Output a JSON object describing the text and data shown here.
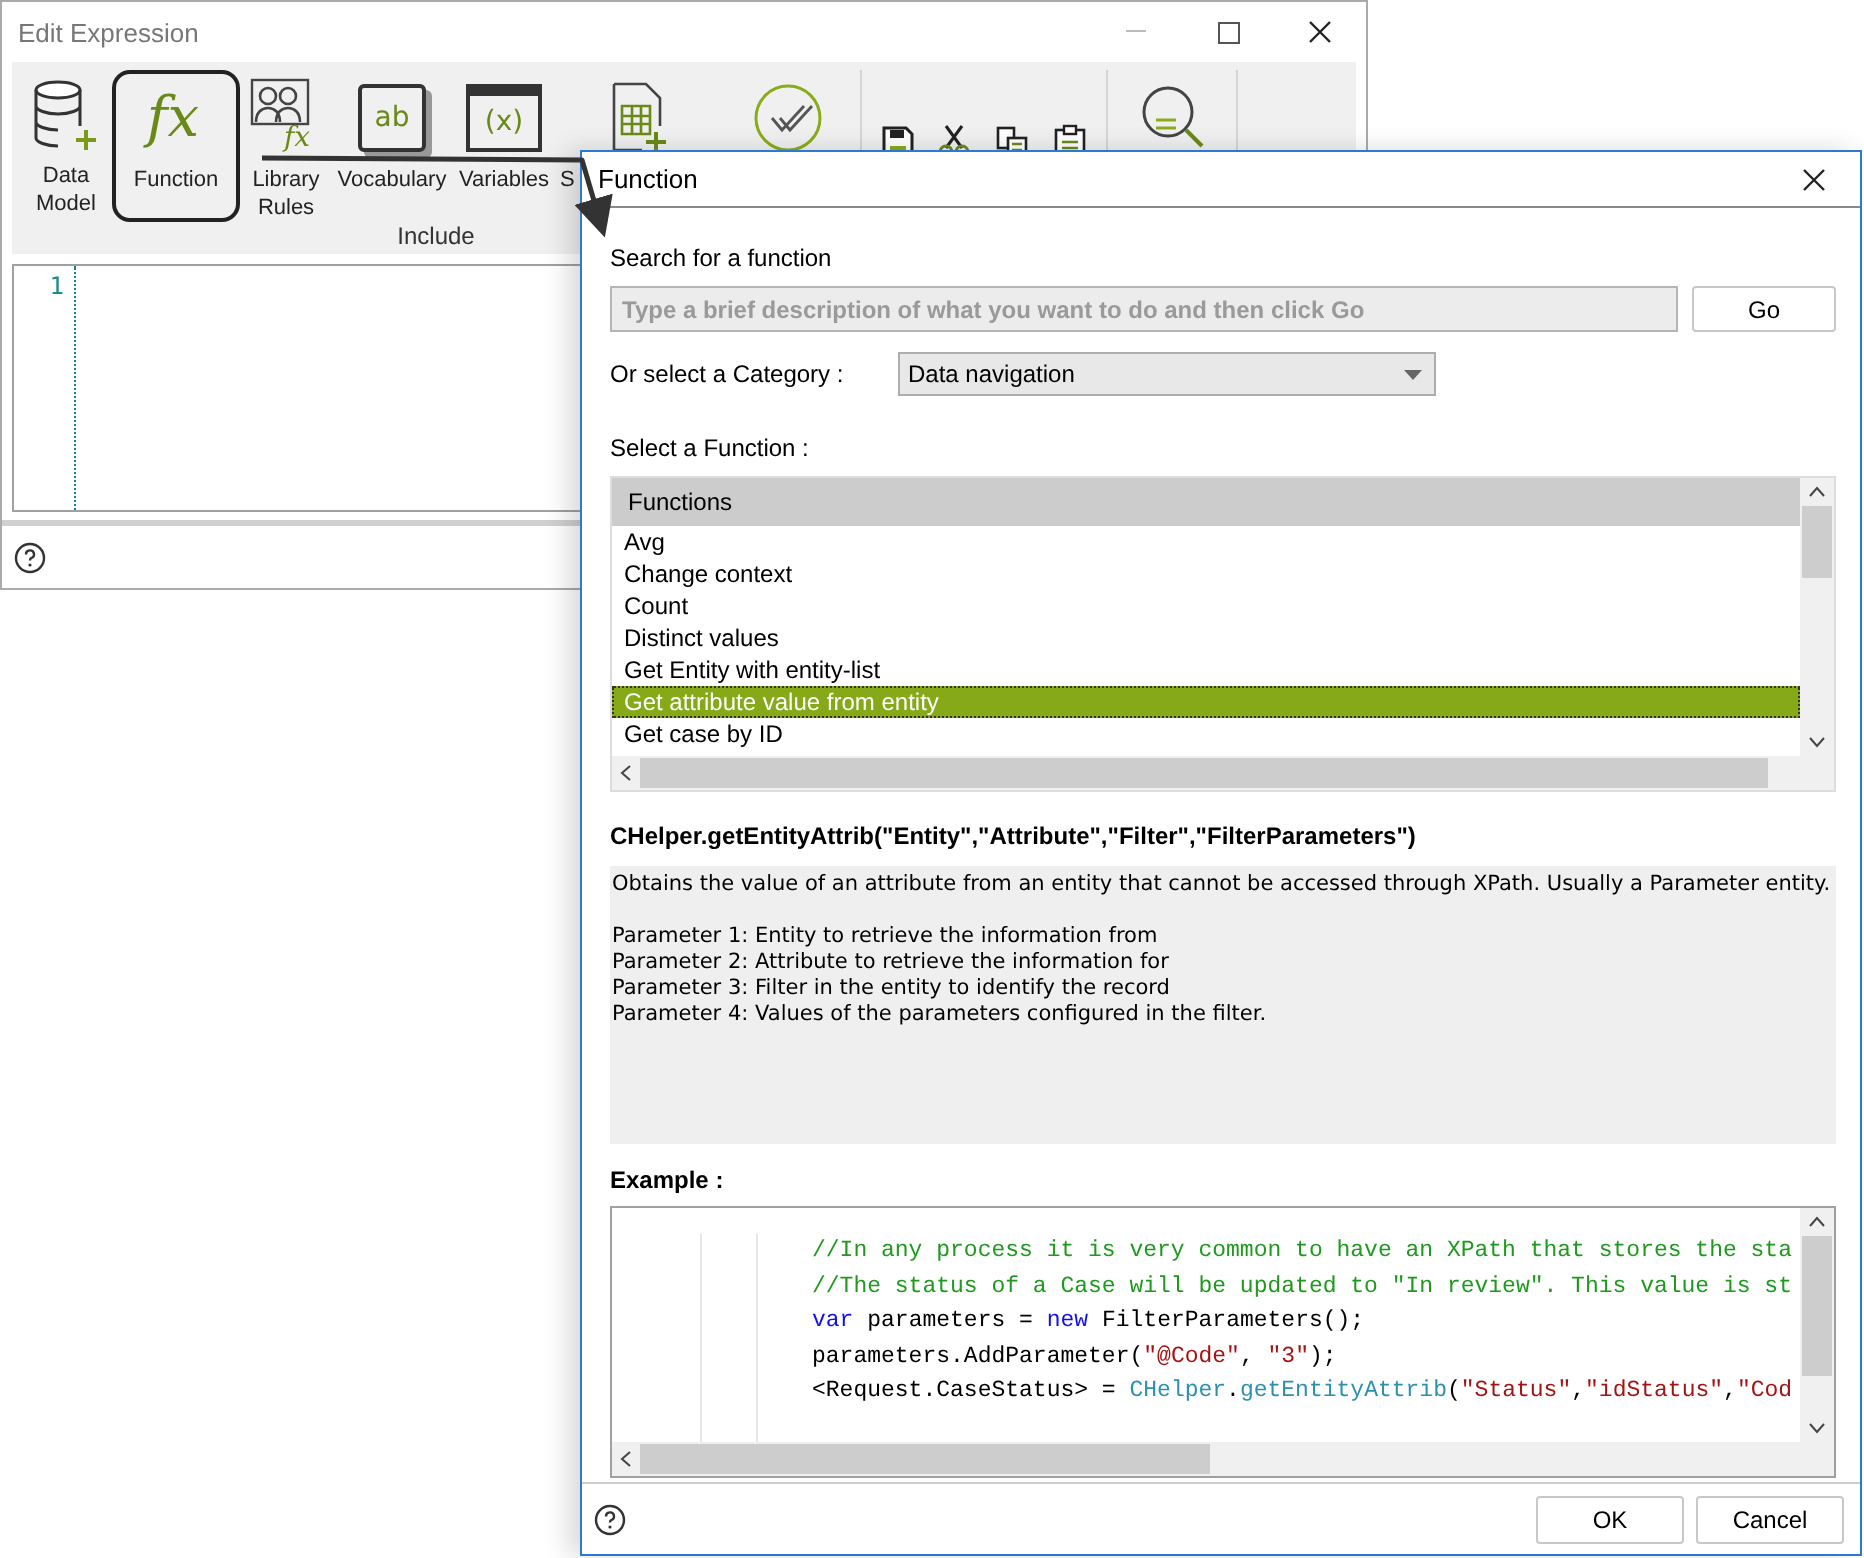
{
  "editor_window": {
    "title": "Edit Expression",
    "toolbar_groups": [
      {
        "label": "Include",
        "items": [
          {
            "kind": "database",
            "label": "Data Model",
            "outlined": false
          },
          {
            "kind": "function",
            "glyph": "fx",
            "label": "Function",
            "outlined": true
          },
          {
            "kind": "library",
            "glyph": "fx",
            "label": "Library Rules",
            "outlined": false
          },
          {
            "kind": "vocabulary",
            "glyph": "ab",
            "label": "Vocabulary",
            "outlined": false
          },
          {
            "kind": "variables",
            "glyph": "(x)",
            "label": "Variables",
            "outlined": false
          },
          {
            "kind": "table",
            "label": "S",
            "outlined": false
          },
          {
            "kind": "check",
            "outlined": false
          }
        ]
      },
      {
        "items": [
          {
            "kind": "save",
            "outlined": false
          },
          {
            "kind": "cut",
            "outlined": false
          },
          {
            "kind": "copy",
            "outlined": false
          },
          {
            "kind": "paste",
            "outlined": false
          }
        ]
      },
      {
        "items": [
          {
            "kind": "search",
            "outlined": false
          }
        ]
      }
    ],
    "line_numbers": [
      "1"
    ]
  },
  "function_dialog": {
    "title": "Function",
    "search_label": "Search for a function",
    "search_placeholder": "Type a brief description of what you want to do and then click Go",
    "go_button": "Go",
    "category_label": "Or select a Category :",
    "category_value": "Data navigation",
    "function_label": "Select a Function :",
    "list_header": "Functions",
    "functions": [
      {
        "name": "Avg",
        "selected": false
      },
      {
        "name": "Change context",
        "selected": false
      },
      {
        "name": "Count",
        "selected": false
      },
      {
        "name": "Distinct values",
        "selected": false
      },
      {
        "name": "Get Entity with entity-list",
        "selected": false
      },
      {
        "name": "Get attribute value from entity",
        "selected": true
      },
      {
        "name": "Get case by ID",
        "selected": false
      }
    ],
    "signature": "CHelper.getEntityAttrib(\"Entity\",\"Attribute\",\"Filter\",\"FilterParameters\")",
    "description_summary": "Obtains the value of an attribute from an entity that cannot be accessed through XPath. Usually a Parameter entity.",
    "description_parameters": [
      "Parameter 1: Entity to retrieve the information from",
      "Parameter 2: Attribute to retrieve the information for",
      "Parameter 3: Filter in the entity to identify the record",
      "Parameter 4: Values of the parameters configured in the filter."
    ],
    "example_label": "Example :",
    "example_lines": [
      [
        {
          "kind": "comment",
          "text": "//In any process it is very common to have an XPath that stores the sta"
        }
      ],
      [
        {
          "kind": "comment",
          "text": "//The status of a Case will be updated to \"In review\". This value is st"
        }
      ],
      [
        {
          "kind": "keyword",
          "text": "var"
        },
        {
          "kind": "plain",
          "text": " parameters = "
        },
        {
          "kind": "keyword",
          "text": "new"
        },
        {
          "kind": "plain",
          "text": " FilterParameters();"
        }
      ],
      [
        {
          "kind": "plain",
          "text": "parameters.AddParameter("
        },
        {
          "kind": "string",
          "text": "\"@Code\""
        },
        {
          "kind": "plain",
          "text": ", "
        },
        {
          "kind": "string",
          "text": "\"3\""
        },
        {
          "kind": "plain",
          "text": ");"
        }
      ],
      [
        {
          "kind": "plain",
          "text": "<Request.CaseStatus> = "
        },
        {
          "kind": "type",
          "text": "CHelper"
        },
        {
          "kind": "plain",
          "text": "."
        },
        {
          "kind": "type",
          "text": "getEntityAttrib"
        },
        {
          "kind": "plain",
          "text": "("
        },
        {
          "kind": "string",
          "text": "\"Status\""
        },
        {
          "kind": "plain",
          "text": ","
        },
        {
          "kind": "string",
          "text": "\"idStatus\""
        },
        {
          "kind": "plain",
          "text": ","
        },
        {
          "kind": "string",
          "text": "\"Cod"
        }
      ]
    ],
    "buttons": [
      "OK",
      "Cancel"
    ]
  }
}
